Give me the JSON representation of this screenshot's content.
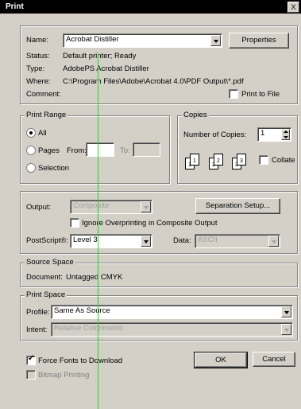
{
  "window": {
    "title": "Print",
    "close_glyph": "X"
  },
  "printer": {
    "name_label": "Name:",
    "name_value": "Acrobat Distiller",
    "properties_button": "Properties",
    "status_label": "Status:",
    "status_value": "Default printer; Ready",
    "type_label": "Type:",
    "type_value": "AdobePS Acrobat Distiller",
    "where_label": "Where:",
    "where_value": "C:\\Program Files\\Adobe\\Acrobat 4.0\\PDF Output\\*.pdf",
    "comment_label": "Comment:",
    "print_to_file_label": "Print to File"
  },
  "print_range": {
    "title": "Print Range",
    "all_label": "All",
    "pages_label": "Pages",
    "from_label": "From:",
    "to_label": "To:",
    "selection_label": "Selection"
  },
  "copies": {
    "title": "Copies",
    "number_label": "Number of Copies:",
    "number_value": "1",
    "collate_label": "Collate",
    "page_icons": [
      "1",
      "1",
      "2",
      "2",
      "3",
      "3"
    ]
  },
  "output": {
    "output_label": "Output:",
    "output_value": "Composite",
    "separation_button": "Separation Setup...",
    "ignore_overprinting_label": "Ignore Overprinting in Composite Output",
    "postscript_label": "PostScript®:",
    "postscript_value": "Level 3",
    "data_label": "Data:",
    "data_value": "ASCII"
  },
  "source_space": {
    "title": "Source Space",
    "document_label": "Document:",
    "document_value": "Untagged CMYK"
  },
  "print_space": {
    "title": "Print Space",
    "profile_label": "Profile:",
    "profile_value": "Same As Source",
    "intent_label": "Intent:",
    "intent_value": "Relative Colorimetric"
  },
  "bottom": {
    "force_fonts_label": "Force Fonts to Download",
    "bitmap_printing_label": "Bitmap Printing",
    "ok_button": "OK",
    "cancel_button": "Cancel"
  },
  "colors": {
    "dialog": "#d4d0c8",
    "overlay_line": "#33cc33"
  }
}
